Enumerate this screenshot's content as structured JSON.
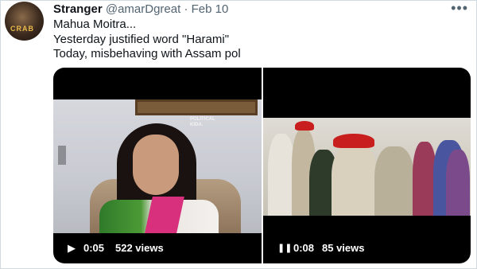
{
  "tweet": {
    "display_name": "Stranger",
    "handle": "@amarDgreat",
    "separator": "·",
    "date": "Feb 10",
    "more_label": "•••",
    "avatar_text": "CRAB",
    "lines": [
      "Mahua Moitra...",
      "Yesterday justified word \"Harami\"",
      "Today, misbehaving with Assam pol"
    ]
  },
  "media": [
    {
      "control": "play",
      "control_glyph": "▶",
      "time": "0:05",
      "views": "522 views",
      "watermark": [
        "POLITICAL",
        "KIDA."
      ]
    },
    {
      "control": "pause",
      "control_glyph": "❚❚",
      "time": "0:08",
      "views": "85 views"
    }
  ],
  "colors": {
    "text": "#0f1419",
    "secondary": "#536471",
    "media_bg": "#000000",
    "border": "#cfd9de"
  }
}
